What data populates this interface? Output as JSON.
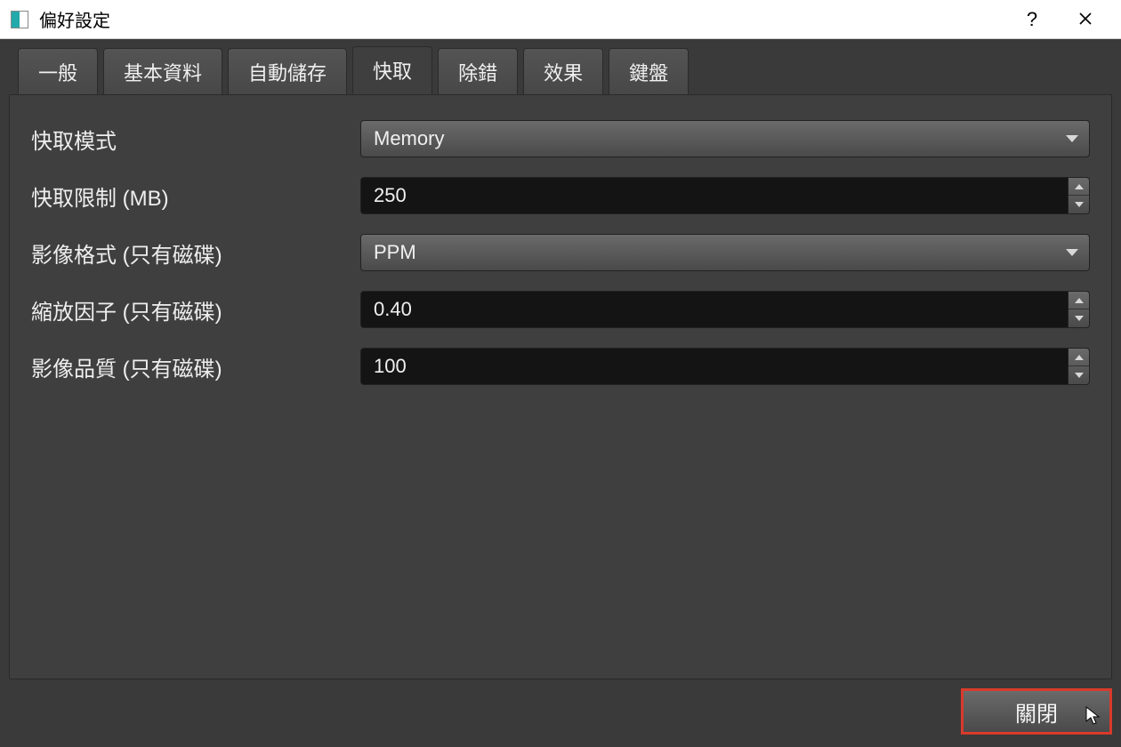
{
  "window": {
    "title": "偏好設定"
  },
  "tabs": {
    "general": "一般",
    "profile": "基本資料",
    "autosave": "自動儲存",
    "cache": "快取",
    "debug": "除錯",
    "effects": "效果",
    "keyboard": "鍵盤",
    "active": "cache"
  },
  "cache_tab": {
    "mode_label": "快取模式",
    "mode_value": "Memory",
    "limit_label": "快取限制 (MB)",
    "limit_value": "250",
    "image_format_label": "影像格式 (只有磁碟)",
    "image_format_value": "PPM",
    "scale_factor_label": "縮放因子 (只有磁碟)",
    "scale_factor_value": "0.40",
    "image_quality_label": "影像品質 (只有磁碟)",
    "image_quality_value": "100"
  },
  "footer": {
    "close_label": "關閉"
  }
}
